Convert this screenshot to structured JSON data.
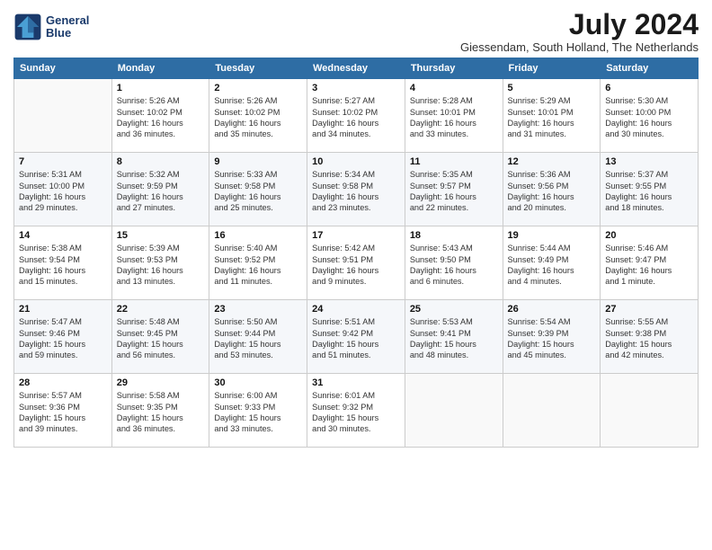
{
  "logo": {
    "line1": "General",
    "line2": "Blue"
  },
  "title": "July 2024",
  "subtitle": "Giessendam, South Holland, The Netherlands",
  "weekdays": [
    "Sunday",
    "Monday",
    "Tuesday",
    "Wednesday",
    "Thursday",
    "Friday",
    "Saturday"
  ],
  "weeks": [
    [
      {
        "day": "",
        "sunrise": "",
        "sunset": "",
        "daylight": ""
      },
      {
        "day": "1",
        "sunrise": "Sunrise: 5:26 AM",
        "sunset": "Sunset: 10:02 PM",
        "daylight": "Daylight: 16 hours and 36 minutes."
      },
      {
        "day": "2",
        "sunrise": "Sunrise: 5:26 AM",
        "sunset": "Sunset: 10:02 PM",
        "daylight": "Daylight: 16 hours and 35 minutes."
      },
      {
        "day": "3",
        "sunrise": "Sunrise: 5:27 AM",
        "sunset": "Sunset: 10:02 PM",
        "daylight": "Daylight: 16 hours and 34 minutes."
      },
      {
        "day": "4",
        "sunrise": "Sunrise: 5:28 AM",
        "sunset": "Sunset: 10:01 PM",
        "daylight": "Daylight: 16 hours and 33 minutes."
      },
      {
        "day": "5",
        "sunrise": "Sunrise: 5:29 AM",
        "sunset": "Sunset: 10:01 PM",
        "daylight": "Daylight: 16 hours and 31 minutes."
      },
      {
        "day": "6",
        "sunrise": "Sunrise: 5:30 AM",
        "sunset": "Sunset: 10:00 PM",
        "daylight": "Daylight: 16 hours and 30 minutes."
      }
    ],
    [
      {
        "day": "7",
        "sunrise": "Sunrise: 5:31 AM",
        "sunset": "Sunset: 10:00 PM",
        "daylight": "Daylight: 16 hours and 29 minutes."
      },
      {
        "day": "8",
        "sunrise": "Sunrise: 5:32 AM",
        "sunset": "Sunset: 9:59 PM",
        "daylight": "Daylight: 16 hours and 27 minutes."
      },
      {
        "day": "9",
        "sunrise": "Sunrise: 5:33 AM",
        "sunset": "Sunset: 9:58 PM",
        "daylight": "Daylight: 16 hours and 25 minutes."
      },
      {
        "day": "10",
        "sunrise": "Sunrise: 5:34 AM",
        "sunset": "Sunset: 9:58 PM",
        "daylight": "Daylight: 16 hours and 23 minutes."
      },
      {
        "day": "11",
        "sunrise": "Sunrise: 5:35 AM",
        "sunset": "Sunset: 9:57 PM",
        "daylight": "Daylight: 16 hours and 22 minutes."
      },
      {
        "day": "12",
        "sunrise": "Sunrise: 5:36 AM",
        "sunset": "Sunset: 9:56 PM",
        "daylight": "Daylight: 16 hours and 20 minutes."
      },
      {
        "day": "13",
        "sunrise": "Sunrise: 5:37 AM",
        "sunset": "Sunset: 9:55 PM",
        "daylight": "Daylight: 16 hours and 18 minutes."
      }
    ],
    [
      {
        "day": "14",
        "sunrise": "Sunrise: 5:38 AM",
        "sunset": "Sunset: 9:54 PM",
        "daylight": "Daylight: 16 hours and 15 minutes."
      },
      {
        "day": "15",
        "sunrise": "Sunrise: 5:39 AM",
        "sunset": "Sunset: 9:53 PM",
        "daylight": "Daylight: 16 hours and 13 minutes."
      },
      {
        "day": "16",
        "sunrise": "Sunrise: 5:40 AM",
        "sunset": "Sunset: 9:52 PM",
        "daylight": "Daylight: 16 hours and 11 minutes."
      },
      {
        "day": "17",
        "sunrise": "Sunrise: 5:42 AM",
        "sunset": "Sunset: 9:51 PM",
        "daylight": "Daylight: 16 hours and 9 minutes."
      },
      {
        "day": "18",
        "sunrise": "Sunrise: 5:43 AM",
        "sunset": "Sunset: 9:50 PM",
        "daylight": "Daylight: 16 hours and 6 minutes."
      },
      {
        "day": "19",
        "sunrise": "Sunrise: 5:44 AM",
        "sunset": "Sunset: 9:49 PM",
        "daylight": "Daylight: 16 hours and 4 minutes."
      },
      {
        "day": "20",
        "sunrise": "Sunrise: 5:46 AM",
        "sunset": "Sunset: 9:47 PM",
        "daylight": "Daylight: 16 hours and 1 minute."
      }
    ],
    [
      {
        "day": "21",
        "sunrise": "Sunrise: 5:47 AM",
        "sunset": "Sunset: 9:46 PM",
        "daylight": "Daylight: 15 hours and 59 minutes."
      },
      {
        "day": "22",
        "sunrise": "Sunrise: 5:48 AM",
        "sunset": "Sunset: 9:45 PM",
        "daylight": "Daylight: 15 hours and 56 minutes."
      },
      {
        "day": "23",
        "sunrise": "Sunrise: 5:50 AM",
        "sunset": "Sunset: 9:44 PM",
        "daylight": "Daylight: 15 hours and 53 minutes."
      },
      {
        "day": "24",
        "sunrise": "Sunrise: 5:51 AM",
        "sunset": "Sunset: 9:42 PM",
        "daylight": "Daylight: 15 hours and 51 minutes."
      },
      {
        "day": "25",
        "sunrise": "Sunrise: 5:53 AM",
        "sunset": "Sunset: 9:41 PM",
        "daylight": "Daylight: 15 hours and 48 minutes."
      },
      {
        "day": "26",
        "sunrise": "Sunrise: 5:54 AM",
        "sunset": "Sunset: 9:39 PM",
        "daylight": "Daylight: 15 hours and 45 minutes."
      },
      {
        "day": "27",
        "sunrise": "Sunrise: 5:55 AM",
        "sunset": "Sunset: 9:38 PM",
        "daylight": "Daylight: 15 hours and 42 minutes."
      }
    ],
    [
      {
        "day": "28",
        "sunrise": "Sunrise: 5:57 AM",
        "sunset": "Sunset: 9:36 PM",
        "daylight": "Daylight: 15 hours and 39 minutes."
      },
      {
        "day": "29",
        "sunrise": "Sunrise: 5:58 AM",
        "sunset": "Sunset: 9:35 PM",
        "daylight": "Daylight: 15 hours and 36 minutes."
      },
      {
        "day": "30",
        "sunrise": "Sunrise: 6:00 AM",
        "sunset": "Sunset: 9:33 PM",
        "daylight": "Daylight: 15 hours and 33 minutes."
      },
      {
        "day": "31",
        "sunrise": "Sunrise: 6:01 AM",
        "sunset": "Sunset: 9:32 PM",
        "daylight": "Daylight: 15 hours and 30 minutes."
      },
      {
        "day": "",
        "sunrise": "",
        "sunset": "",
        "daylight": ""
      },
      {
        "day": "",
        "sunrise": "",
        "sunset": "",
        "daylight": ""
      },
      {
        "day": "",
        "sunrise": "",
        "sunset": "",
        "daylight": ""
      }
    ]
  ]
}
